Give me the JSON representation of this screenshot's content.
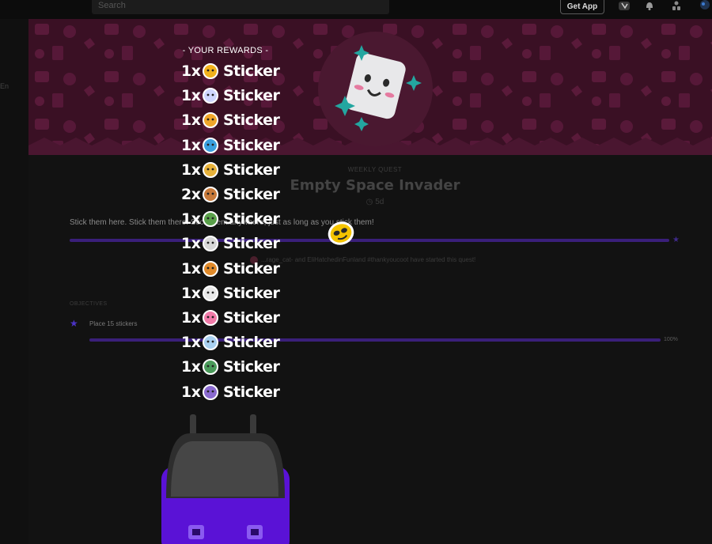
{
  "topbar": {
    "search_placeholder": "Search",
    "get_app_label": "Get App",
    "icons": [
      "store-icon",
      "bell-icon",
      "users-icon",
      "profile-icon"
    ]
  },
  "leftrail": {
    "fragment": "En"
  },
  "quest": {
    "category": "WEEKLY QUEST",
    "title": "Empty Space Invader",
    "time_left": "5d",
    "description": "Stick them here. Stick them there. Stick them anywhere, just as long as you stick them!",
    "started_text": "...rage_cat- and EliHatchedinFunland #thankyoucoot have started this quest!",
    "objectives_header": "OBJECTIVES",
    "objectives": [
      {
        "label": "Place 15 stickers",
        "progress_text": "100%",
        "progress": 1.0
      }
    ]
  },
  "rewards": {
    "title": "- YOUR REWARDS -",
    "items": [
      {
        "qty": "1x",
        "label": "Sticker",
        "icon": "yellow-car-sticker-icon",
        "color": "#f2b21c"
      },
      {
        "qty": "1x",
        "label": "Sticker",
        "icon": "ghost-sticker-icon",
        "color": "#cfd7ff"
      },
      {
        "qty": "1x",
        "label": "Sticker",
        "icon": "laughing-face-sticker-icon",
        "color": "#f0a62a"
      },
      {
        "qty": "1x",
        "label": "Sticker",
        "icon": "lol-sticker-icon",
        "color": "#3aa0e0"
      },
      {
        "qty": "1x",
        "label": "Sticker",
        "icon": "explosion-sticker-icon",
        "color": "#e7b23a"
      },
      {
        "qty": "2x",
        "label": "Sticker",
        "icon": "boy-face-sticker-icon",
        "color": "#c87a3a"
      },
      {
        "qty": "1x",
        "label": "Sticker",
        "icon": "cap-face-sticker-icon",
        "color": "#5aa04a"
      },
      {
        "qty": "1x",
        "label": "Sticker",
        "icon": "sunglasses-sticker-icon",
        "color": "#d8d8d8"
      },
      {
        "qty": "1x",
        "label": "Sticker",
        "icon": "guitar-sticker-icon",
        "color": "#e08a2a"
      },
      {
        "qty": "1x",
        "label": "Sticker",
        "icon": "bowtie-sticker-icon",
        "color": "#e8e8e8"
      },
      {
        "qty": "1x",
        "label": "Sticker",
        "icon": "pink-bow-sticker-icon",
        "color": "#f07aa8"
      },
      {
        "qty": "1x",
        "label": "Sticker",
        "icon": "cloud-cap-sticker-icon",
        "color": "#a8d0f0"
      },
      {
        "qty": "1x",
        "label": "Sticker",
        "icon": "duck-sticker-icon",
        "color": "#4a9a5a"
      },
      {
        "qty": "1x",
        "label": "Sticker",
        "icon": "purple-hood-sticker-icon",
        "color": "#8a6ad0"
      }
    ]
  },
  "colors": {
    "banner_bg": "#3a1024",
    "accent_purple": "#5a22d6",
    "progress_track": "#3a1f7a"
  }
}
